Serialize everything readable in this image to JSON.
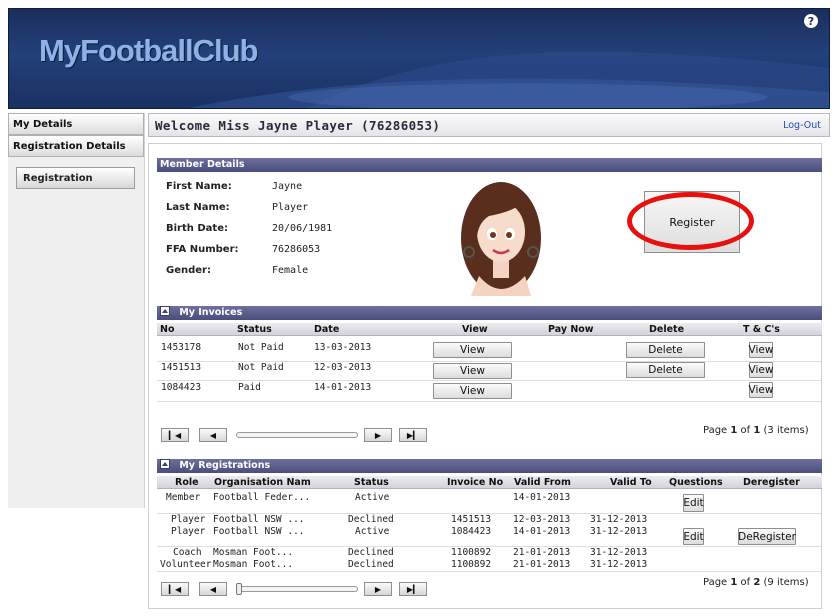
{
  "app": {
    "logo": "MyFootballClub",
    "help": "?"
  },
  "sidebar": {
    "items": [
      "My Details",
      "Registration Details"
    ],
    "sub_item": "Registration"
  },
  "welcome": {
    "title": "Welcome Miss Jayne Player (76286053)",
    "logout": "Log-Out"
  },
  "member_details": {
    "heading": "Member Details",
    "fields": [
      {
        "label": "First Name:",
        "value": "Jayne"
      },
      {
        "label": "Last Name:",
        "value": "Player"
      },
      {
        "label": "Birth Date:",
        "value": "20/06/1981"
      },
      {
        "label": "FFA Number:",
        "value": "76286053"
      },
      {
        "label": "Gender:",
        "value": "Female"
      }
    ],
    "register_label": "Register"
  },
  "invoices": {
    "heading": "My Invoices",
    "columns": [
      "No",
      "Status",
      "Date",
      "View",
      "Pay Now",
      "Delete",
      "T & C's"
    ],
    "rows": [
      {
        "no": "1453178",
        "status": "Not Paid",
        "date": "13-03-2013",
        "view": "View",
        "delete": "Delete",
        "tc": "View"
      },
      {
        "no": "1451513",
        "status": "Not Paid",
        "date": "12-03-2013",
        "view": "View",
        "delete": "Delete",
        "tc": "View"
      },
      {
        "no": "1084423",
        "status": "Paid",
        "date": "14-01-2013",
        "view": "View",
        "delete": "",
        "tc": "View"
      }
    ],
    "pager": {
      "prefix": "Page ",
      "page": "1",
      "of": " of ",
      "total": "1",
      "items": " (3 items)"
    }
  },
  "registrations": {
    "heading": "My Registrations",
    "columns": [
      "Role",
      "Organisation Nam",
      "Status",
      "Invoice No",
      "Valid From",
      "Valid To",
      "Questions",
      "Deregister"
    ],
    "rows": [
      {
        "role": "Member",
        "org": "Football Feder...",
        "status": "Active",
        "invoice": "",
        "from": "14-01-2013",
        "to": "",
        "questions": "Edit",
        "deregister": ""
      },
      {
        "role": "Player",
        "org": "Football NSW ...",
        "status": "Declined",
        "invoice": "1451513",
        "from": "12-03-2013",
        "to": "31-12-2013",
        "questions": "",
        "deregister": ""
      },
      {
        "role": "Player",
        "org": "Football NSW ...",
        "status": "Active",
        "invoice": "1084423",
        "from": "14-01-2013",
        "to": "31-12-2013",
        "questions": "Edit",
        "deregister": "DeRegister"
      },
      {
        "role": "Coach",
        "org": "Mosman Foot...",
        "status": "Declined",
        "invoice": "1100892",
        "from": "21-01-2013",
        "to": "31-12-2013",
        "questions": "",
        "deregister": ""
      },
      {
        "role": "Volunteer",
        "org": "Mosman Foot...",
        "status": "Declined",
        "invoice": "1100892",
        "from": "21-01-2013",
        "to": "31-12-2013",
        "questions": "",
        "deregister": ""
      }
    ],
    "pager": {
      "prefix": "Page ",
      "page": "1",
      "of": " of ",
      "total": "2",
      "items": " (9 items)"
    }
  },
  "colors": {
    "banner": "#23407a",
    "section": "#5a5c8a",
    "highlight": "#e8100f",
    "link": "#1f4fb6"
  }
}
